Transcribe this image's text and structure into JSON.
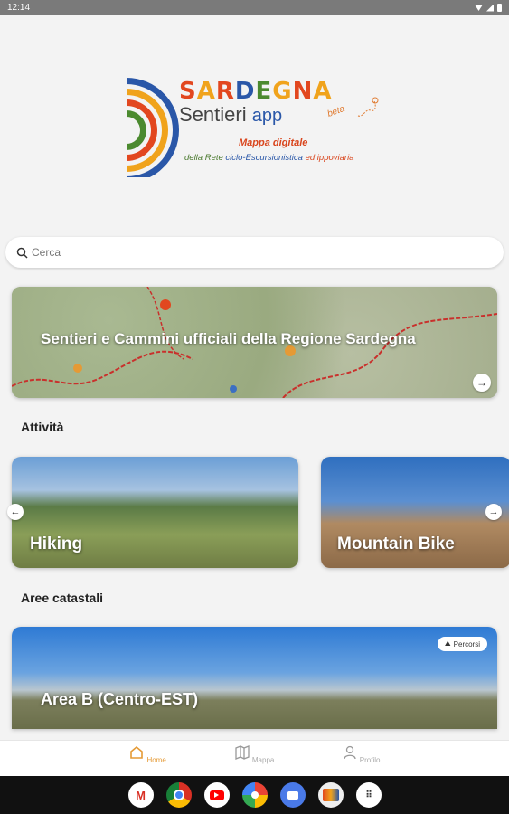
{
  "status_bar": {
    "time": "12:14",
    "icons": [
      "wifi-icon",
      "signal-icon",
      "battery-icon"
    ]
  },
  "logo": {
    "title_letters": [
      {
        "char": "S",
        "color": "#e2471f"
      },
      {
        "char": "A",
        "color": "#f0a31c"
      },
      {
        "char": "R",
        "color": "#e2471f"
      },
      {
        "char": "D",
        "color": "#2a57a8"
      },
      {
        "char": "E",
        "color": "#4b8a2f"
      },
      {
        "char": "G",
        "color": "#f0a31c"
      },
      {
        "char": "N",
        "color": "#e2471f"
      },
      {
        "char": "A",
        "color": "#f0a31c"
      }
    ],
    "subtitle": "Sentieri",
    "app_word": "app",
    "beta": "beta",
    "line1": "Mappa digitale",
    "line2_part1": "della Rete ",
    "line2_part2": "ciclo-Escursionistica",
    "line2_part3": " ed ippoviaria",
    "arc_colors": [
      "#2a57a8",
      "#f0a31c",
      "#e2471f",
      "#4b8a2f"
    ]
  },
  "search": {
    "placeholder": "Cerca",
    "value": ""
  },
  "hero": {
    "title": "Sentieri e Cammini ufficiali della Regione Sardegna"
  },
  "sections": {
    "activities": "Attività",
    "areas": "Aree catastali"
  },
  "activities": [
    {
      "label": "Hiking"
    },
    {
      "label": "Mountain Bike"
    }
  ],
  "area_card": {
    "title": "Area B (Centro-EST)",
    "badge": "Percorsi"
  },
  "bottom_nav": [
    {
      "label": "Home",
      "icon": "home-icon",
      "active": true
    },
    {
      "label": "Mappa",
      "icon": "map-icon",
      "active": false
    },
    {
      "label": "Profilo",
      "icon": "profile-icon",
      "active": false
    }
  ],
  "taskbar_apps": [
    "gmail-icon",
    "chrome-icon",
    "youtube-icon",
    "photos-icon",
    "messages-icon",
    "sardegna-app-icon",
    "app-drawer-icon"
  ],
  "colors": {
    "accent": "#e59a35",
    "background": "#f3f3f3"
  }
}
